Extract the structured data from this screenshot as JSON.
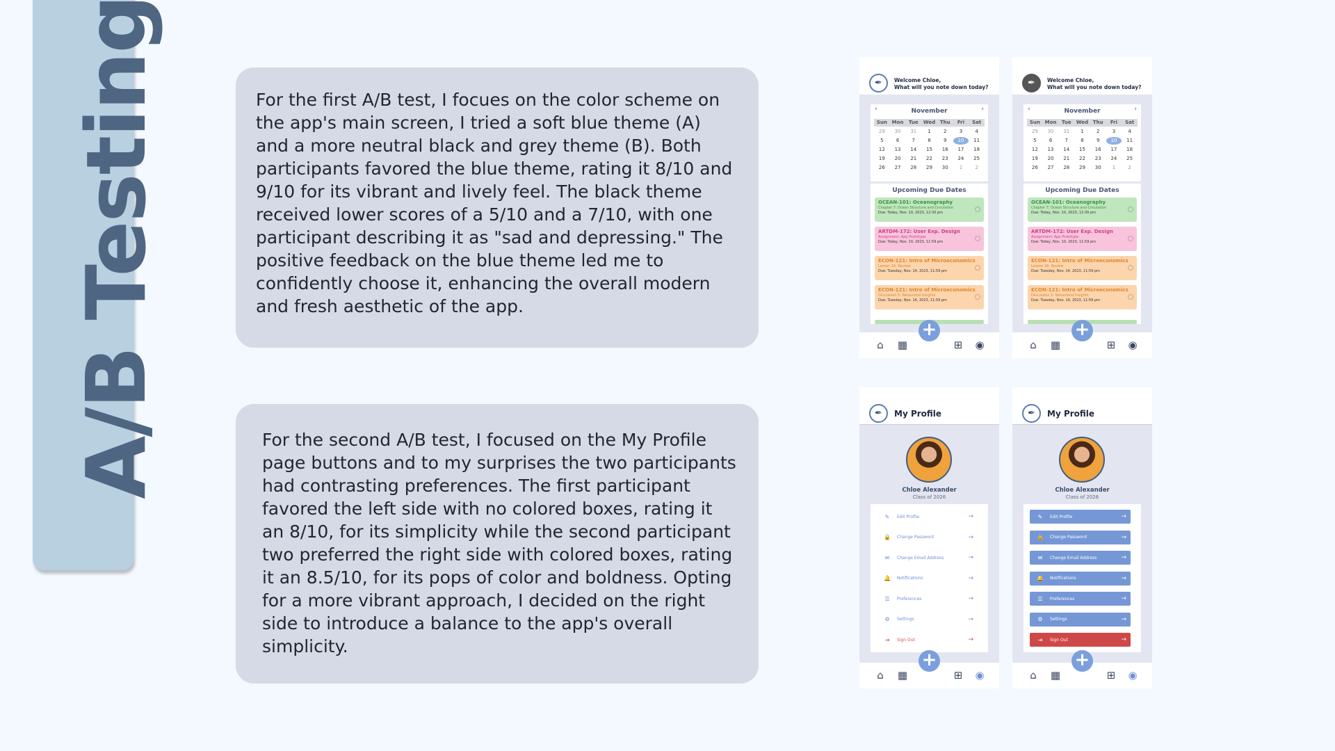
{
  "side_title": "A/B Testing",
  "paragraphs": {
    "test1": "For the first A/B test, I focues on the color scheme on the app's main screen, I tried a soft blue theme (A) and a more neutral black and grey theme (B). Both participants favored the blue theme, rating it 8/10 and 9/10 for its vibrant and lively feel. The black theme received lower scores of a 5/10 and a 7/10, with one participant describing it as \"sad and depressing.\" The positive feedback on the blue theme led me to confidently choose it, enhancing the overall modern and fresh aesthetic of the app.",
    "test2": "For the second A/B test, I focused on the My Profile page buttons and to my surprises the two participants had contrasting preferences. The first participant favored the left side with no colored boxes, rating it an 8/10, for its simplicity while the second participant two preferred the right side with colored boxes, rating it an 8.5/10, for its pops of color and boldness. Opting for a more vibrant approach, I decided on the right side to introduce a balance to the app's overall simplicity."
  },
  "home": {
    "welcome_line1": "Welcome Chloe,",
    "welcome_line2": "What will you note down today?",
    "calendar": {
      "prev": "‹",
      "next": "›",
      "month": "November",
      "weekdays": [
        "Sun",
        "Mon",
        "Tue",
        "Wed",
        "Thu",
        "Fri",
        "Sat"
      ],
      "days": [
        "29",
        "30",
        "31",
        "1",
        "2",
        "3",
        "4",
        "5",
        "6",
        "7",
        "8",
        "9",
        "10",
        "11",
        "12",
        "13",
        "14",
        "15",
        "16",
        "17",
        "18",
        "19",
        "20",
        "21",
        "22",
        "23",
        "24",
        "25",
        "26",
        "27",
        "28",
        "29",
        "30",
        "1",
        "2"
      ],
      "selected": "10"
    },
    "due_title": "Upcoming Due Dates",
    "due_items": [
      {
        "course": "OCEAN-101: Oceanography",
        "sub": "Chapter 7: Ocean Structure and Circulation",
        "date": "Due: Today, Nov. 10, 2023, 12:30 pm",
        "bg": "#bfe6bd",
        "color": "#3f8f45"
      },
      {
        "course": "ARTDM-172: User Exp. Design",
        "sub": "Assignment: App Prototype",
        "date": "Due: Today, Nov. 10, 2023, 11:59 pm",
        "bg": "#f8c4dc",
        "color": "#d03f86"
      },
      {
        "course": "ECON-121: Intro of Microeconomics",
        "sub": "Lesson 16: Review",
        "date": "Due: Tuesday, Nov. 14, 2023, 11:59 pm",
        "bg": "#fcd5ac",
        "color": "#e0842c"
      },
      {
        "course": "ECON-121: Intro of Microeconomics",
        "sub": "Discussion 5: Behavioral Insights",
        "date": "Due: Tuesday, Nov. 14, 2023, 11:59 pm",
        "bg": "#fcd5ac",
        "color": "#e0842c"
      }
    ]
  },
  "profile": {
    "title": "My Profile",
    "name": "Chloe Alexander",
    "class": "Class of 2026",
    "menu": [
      {
        "label": "Edit Profile",
        "icon": "✎"
      },
      {
        "label": "Change Password",
        "icon": "🔒"
      },
      {
        "label": "Change Email Address",
        "icon": "✉"
      },
      {
        "label": "Notifications",
        "icon": "🔔"
      },
      {
        "label": "Preferences",
        "icon": "☰"
      },
      {
        "label": "Settings",
        "icon": "⚙"
      },
      {
        "label": "Sign Out",
        "icon": "⇥"
      }
    ]
  },
  "nav": {
    "home": "⌂",
    "calendar": "▦",
    "fab": "+",
    "grid": "⊞",
    "profile": "◉"
  },
  "colors": {
    "accent": "#7a9fdc",
    "panel": "#d5dae6",
    "tab": "#b8d0e0",
    "title": "#4e6682"
  }
}
